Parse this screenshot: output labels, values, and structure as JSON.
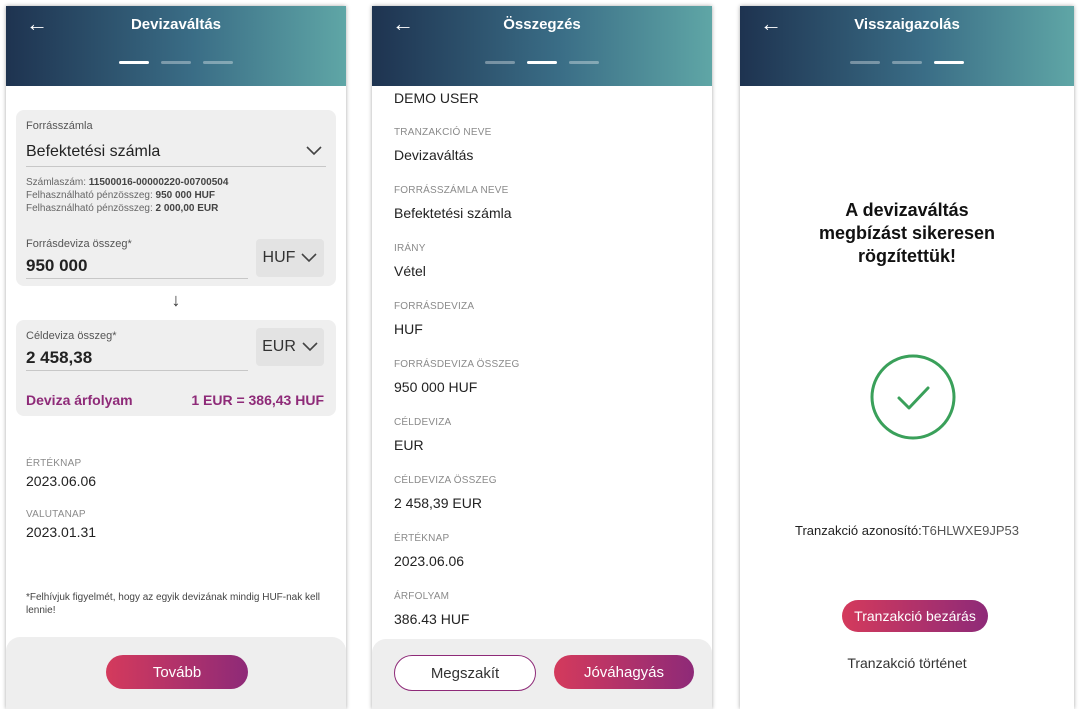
{
  "screens": {
    "exchange": {
      "title": "Devizaváltás",
      "source_account_label": "Forrásszámla",
      "source_account_value": "Befektetési számla",
      "account_number_label": "Számlaszám: ",
      "account_number": "11500016-00000220-00700504",
      "available_label_1": "Felhasználható pénzösszeg: ",
      "available_huf": "950 000 HUF",
      "available_label_2": "Felhasználható pénzösszeg: ",
      "available_eur": "2 000,00 EUR",
      "source_amount_label": "Forrásdeviza összeg*",
      "source_amount_value": "950 000",
      "source_currency": "HUF",
      "swap_arrow": "↓",
      "target_amount_label": "Céldeviza összeg*",
      "target_amount_value": "2 458,38",
      "target_currency": "EUR",
      "rate_label": "Deviza árfolyam",
      "rate_value": "1 EUR = 386,43 HUF",
      "value_date_label": "ÉRTÉKNAP",
      "value_date": "2023.06.06",
      "currency_date_label": "VALUTANAP",
      "currency_date": "2023.01.31",
      "note": "*Felhívjuk figyelmét, hogy az egyik devizának mindig HUF-nak kell lennie!",
      "next_button": "Tovább"
    },
    "summary": {
      "title": "Összegzés",
      "user": "DEMO USER",
      "rows": [
        {
          "label": "TRANZAKCIÓ NEVE",
          "value": "Devizaváltás"
        },
        {
          "label": "FORRÁSSZÁMLA NEVE",
          "value": "Befektetési számla"
        },
        {
          "label": "IRÁNY",
          "value": "Vétel"
        },
        {
          "label": "FORRÁSDEVIZA",
          "value": "HUF"
        },
        {
          "label": "FORRÁSDEVIZA ÖSSZEG",
          "value": "950 000 HUF"
        },
        {
          "label": "CÉLDEVIZA",
          "value": "EUR"
        },
        {
          "label": "CÉLDEVIZA ÖSSZEG",
          "value": "2 458,39 EUR"
        },
        {
          "label": "ÉRTÉKNAP",
          "value": "2023.06.06"
        },
        {
          "label": "ÁRFOLYAM",
          "value": "386.43 HUF"
        }
      ],
      "cancel_button": "Megszakít",
      "approve_button": "Jóváhagyás"
    },
    "confirmation": {
      "title": "Visszaigazolás",
      "message": "A devizaváltás megbízást sikeresen rögzítettük!",
      "transaction_id_label": "Tranzakció azonosító:",
      "transaction_id": "T6HLWXE9JP53",
      "close_button": "Tranzakció bezárás",
      "history_link": "Tranzakció történet"
    }
  },
  "icons": {
    "back": "arrow-left-icon",
    "chevron": "chevron-down-icon",
    "success": "check-circle-icon",
    "swap": "arrow-down-icon"
  },
  "colors": {
    "accent": "#8e2a78",
    "accent_start": "#d43a5c",
    "success": "#3aa05a",
    "header_start": "#1e3350",
    "header_end": "#5fa6a6"
  },
  "steps": {
    "exchange_active": 1,
    "summary_active": 2,
    "confirmation_active": 3,
    "total": 3
  }
}
